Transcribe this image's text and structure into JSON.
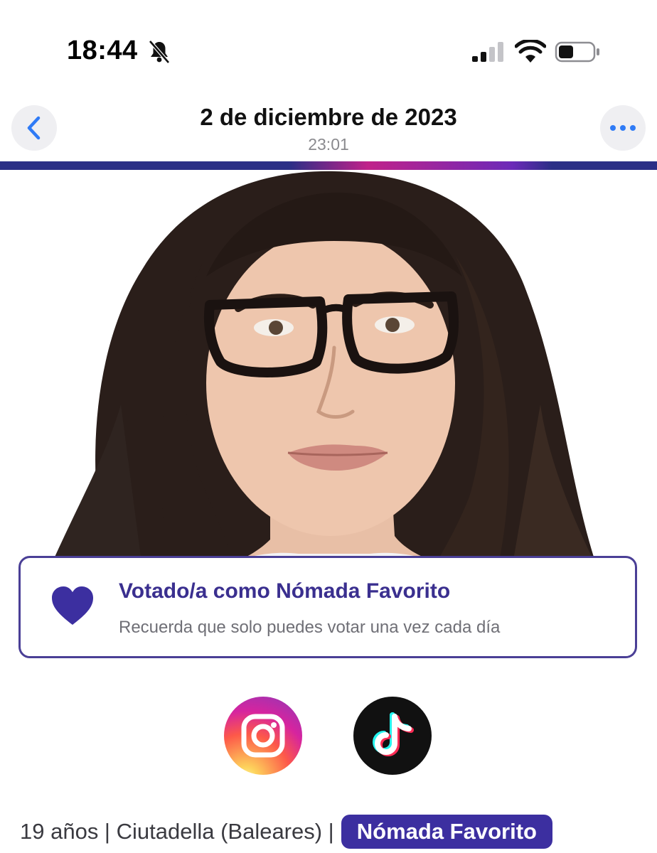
{
  "status_bar": {
    "time": "18:44",
    "icons": [
      "bell-slash-icon",
      "cell-signal-icon",
      "wifi-icon",
      "battery-icon"
    ]
  },
  "nav": {
    "title": "2 de diciembre de 2023",
    "subtitle": "23:01",
    "back_icon": "chevron-left-icon",
    "more_icon": "ellipsis-icon"
  },
  "photo": {
    "subject": "portrait-photo"
  },
  "vote_card": {
    "icon": "heart-icon",
    "title": "Votado/a como Nómada Favorito",
    "subtitle": "Recuerda que solo puedes votar una vez cada día"
  },
  "social": [
    {
      "name": "instagram-icon"
    },
    {
      "name": "tiktok-icon"
    }
  ],
  "profile_line": {
    "info": "19 años | Ciutadella (Baleares) |",
    "badge": "Nómada Favorito"
  },
  "colors": {
    "accent_navy": "#2b2f86",
    "accent_magenta": "#c0228a",
    "brand_purple": "#3c2fa0",
    "ios_blue": "#2f7bf6"
  }
}
